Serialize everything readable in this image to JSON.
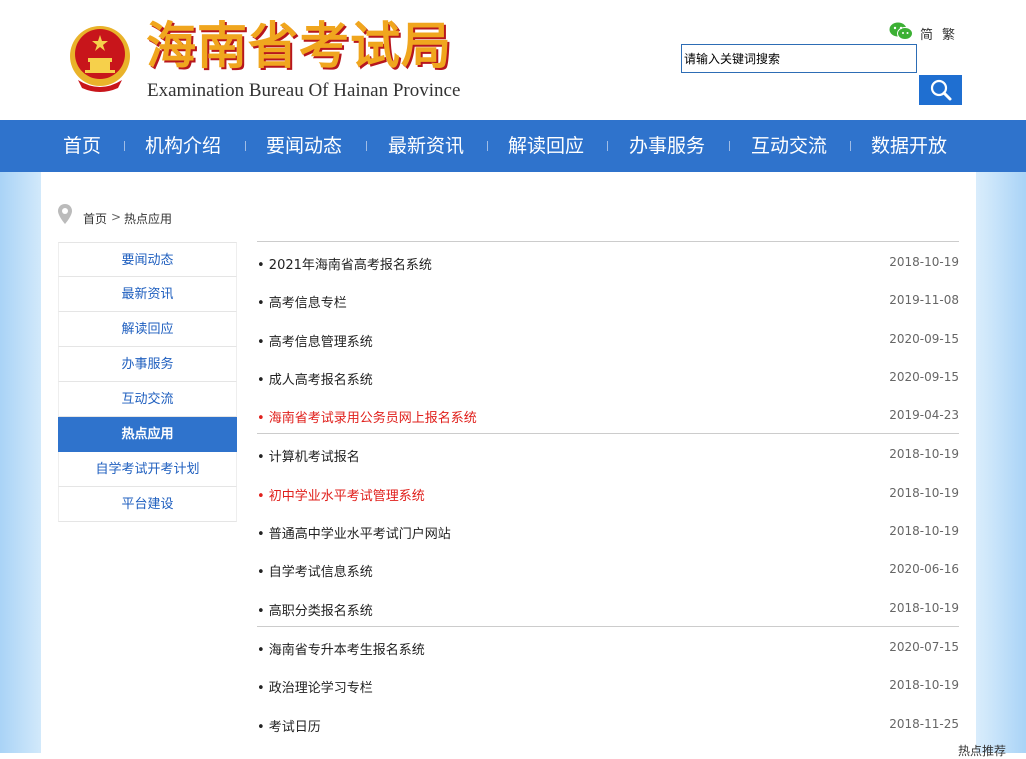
{
  "header": {
    "title": "海南省考试局",
    "subtitle": "Examination Bureau Of Hainan Province",
    "lang_simplified": "简",
    "lang_traditional": "繁",
    "search_placeholder": "请输入关键词搜索",
    "colors": {
      "title": "#f0a61e",
      "title_shadow": "#b7161d",
      "accent": "#2f73cc"
    }
  },
  "nav": {
    "items": [
      {
        "label": "首页"
      },
      {
        "label": "机构介绍"
      },
      {
        "label": "要闻动态"
      },
      {
        "label": "最新资讯"
      },
      {
        "label": "解读回应"
      },
      {
        "label": "办事服务"
      },
      {
        "label": "互动交流"
      },
      {
        "label": "数据开放"
      }
    ]
  },
  "breadcrumb": {
    "home": "首页",
    "separator": ">",
    "current": "热点应用"
  },
  "sidebar": {
    "items": [
      {
        "label": "要闻动态",
        "active": false
      },
      {
        "label": "最新资讯",
        "active": false
      },
      {
        "label": "解读回应",
        "active": false
      },
      {
        "label": "办事服务",
        "active": false
      },
      {
        "label": "互动交流",
        "active": false
      },
      {
        "label": "热点应用",
        "active": true
      },
      {
        "label": "自学考试开考计划",
        "active": false
      },
      {
        "label": "平台建设",
        "active": false
      }
    ]
  },
  "list": {
    "items": [
      {
        "title": "2021年海南省高考报名系统",
        "date": "2018-10-19",
        "highlight": false
      },
      {
        "title": "高考信息专栏",
        "date": "2019-11-08",
        "highlight": false
      },
      {
        "title": "高考信息管理系统",
        "date": "2020-09-15",
        "highlight": false
      },
      {
        "title": "成人高考报名系统",
        "date": "2020-09-15",
        "highlight": false
      },
      {
        "title": "海南省考试录用公务员网上报名系统",
        "date": "2019-04-23",
        "highlight": true
      },
      {
        "title": "计算机考试报名",
        "date": "2018-10-19",
        "highlight": false
      },
      {
        "title": "初中学业水平考试管理系统",
        "date": "2018-10-19",
        "highlight": true
      },
      {
        "title": "普通高中学业水平考试门户网站",
        "date": "2018-10-19",
        "highlight": false
      },
      {
        "title": "自学考试信息系统",
        "date": "2020-06-16",
        "highlight": false
      },
      {
        "title": "高职分类报名系统",
        "date": "2018-10-19",
        "highlight": false
      },
      {
        "title": "海南省专升本考生报名系统",
        "date": "2020-07-15",
        "highlight": false
      },
      {
        "title": "政治理论学习专栏",
        "date": "2018-10-19",
        "highlight": false
      },
      {
        "title": "考试日历",
        "date": "2018-11-25",
        "highlight": false
      }
    ]
  },
  "footer_hint": "热点推荐"
}
